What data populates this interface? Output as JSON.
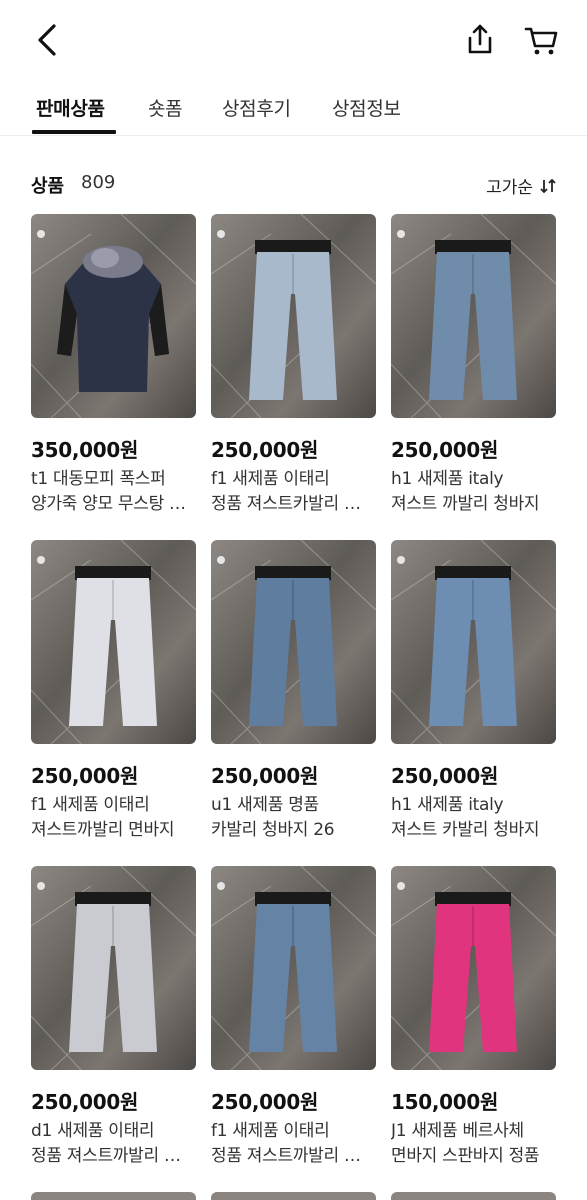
{
  "header": {
    "back_icon": "chevron-left-icon",
    "share_icon": "share-icon",
    "cart_icon": "cart-icon"
  },
  "tabs": [
    {
      "label": "판매상품",
      "active": true
    },
    {
      "label": "숏폼",
      "active": false
    },
    {
      "label": "상점후기",
      "active": false
    },
    {
      "label": "상점정보",
      "active": false
    }
  ],
  "listing": {
    "count_label": "상품",
    "count": "809",
    "sort_label": "고가순",
    "sort_icon": "sort-arrows-icon"
  },
  "products": [
    {
      "price": "350,000원",
      "line1": "t1 대동모피 폭스퍼",
      "line2": "양가죽 양모 무스탕 코트",
      "item": "coat",
      "color": "#2d3347"
    },
    {
      "price": "250,000원",
      "line1": "f1 새제품 이태리",
      "line2": "정품 져스트카발리 청바지",
      "item": "jeans",
      "color": "#a9b9cc"
    },
    {
      "price": "250,000원",
      "line1": "h1 새제품 italy",
      "line2": "져스트 까발리 청바지",
      "item": "jeans",
      "color": "#6f8cab"
    },
    {
      "price": "250,000원",
      "line1": "f1 새제품 이태리",
      "line2": "져스트까발리 면바지",
      "item": "jeans",
      "color": "#dfe0e6"
    },
    {
      "price": "250,000원",
      "line1": "u1 새제품 명품",
      "line2": "카발리 청바지 26",
      "item": "jeans",
      "color": "#5f7d9e"
    },
    {
      "price": "250,000원",
      "line1": "h1 새제품 italy",
      "line2": "져스트 카발리 청바지",
      "item": "jeans",
      "color": "#6d8db2"
    },
    {
      "price": "250,000원",
      "line1": "d1 새제품 이태리",
      "line2": "정품 져스트까발리 면바지",
      "item": "jeans",
      "color": "#c9cbd1"
    },
    {
      "price": "250,000원",
      "line1": "f1 새제품 이태리",
      "line2": "정품 져스트까발리 청바지",
      "item": "jeans",
      "color": "#6583a4"
    },
    {
      "price": "150,000원",
      "line1": "J1 새제품 베르사체",
      "line2": "면바지 스판바지 정품",
      "item": "jeans",
      "color": "#e0357e"
    }
  ]
}
